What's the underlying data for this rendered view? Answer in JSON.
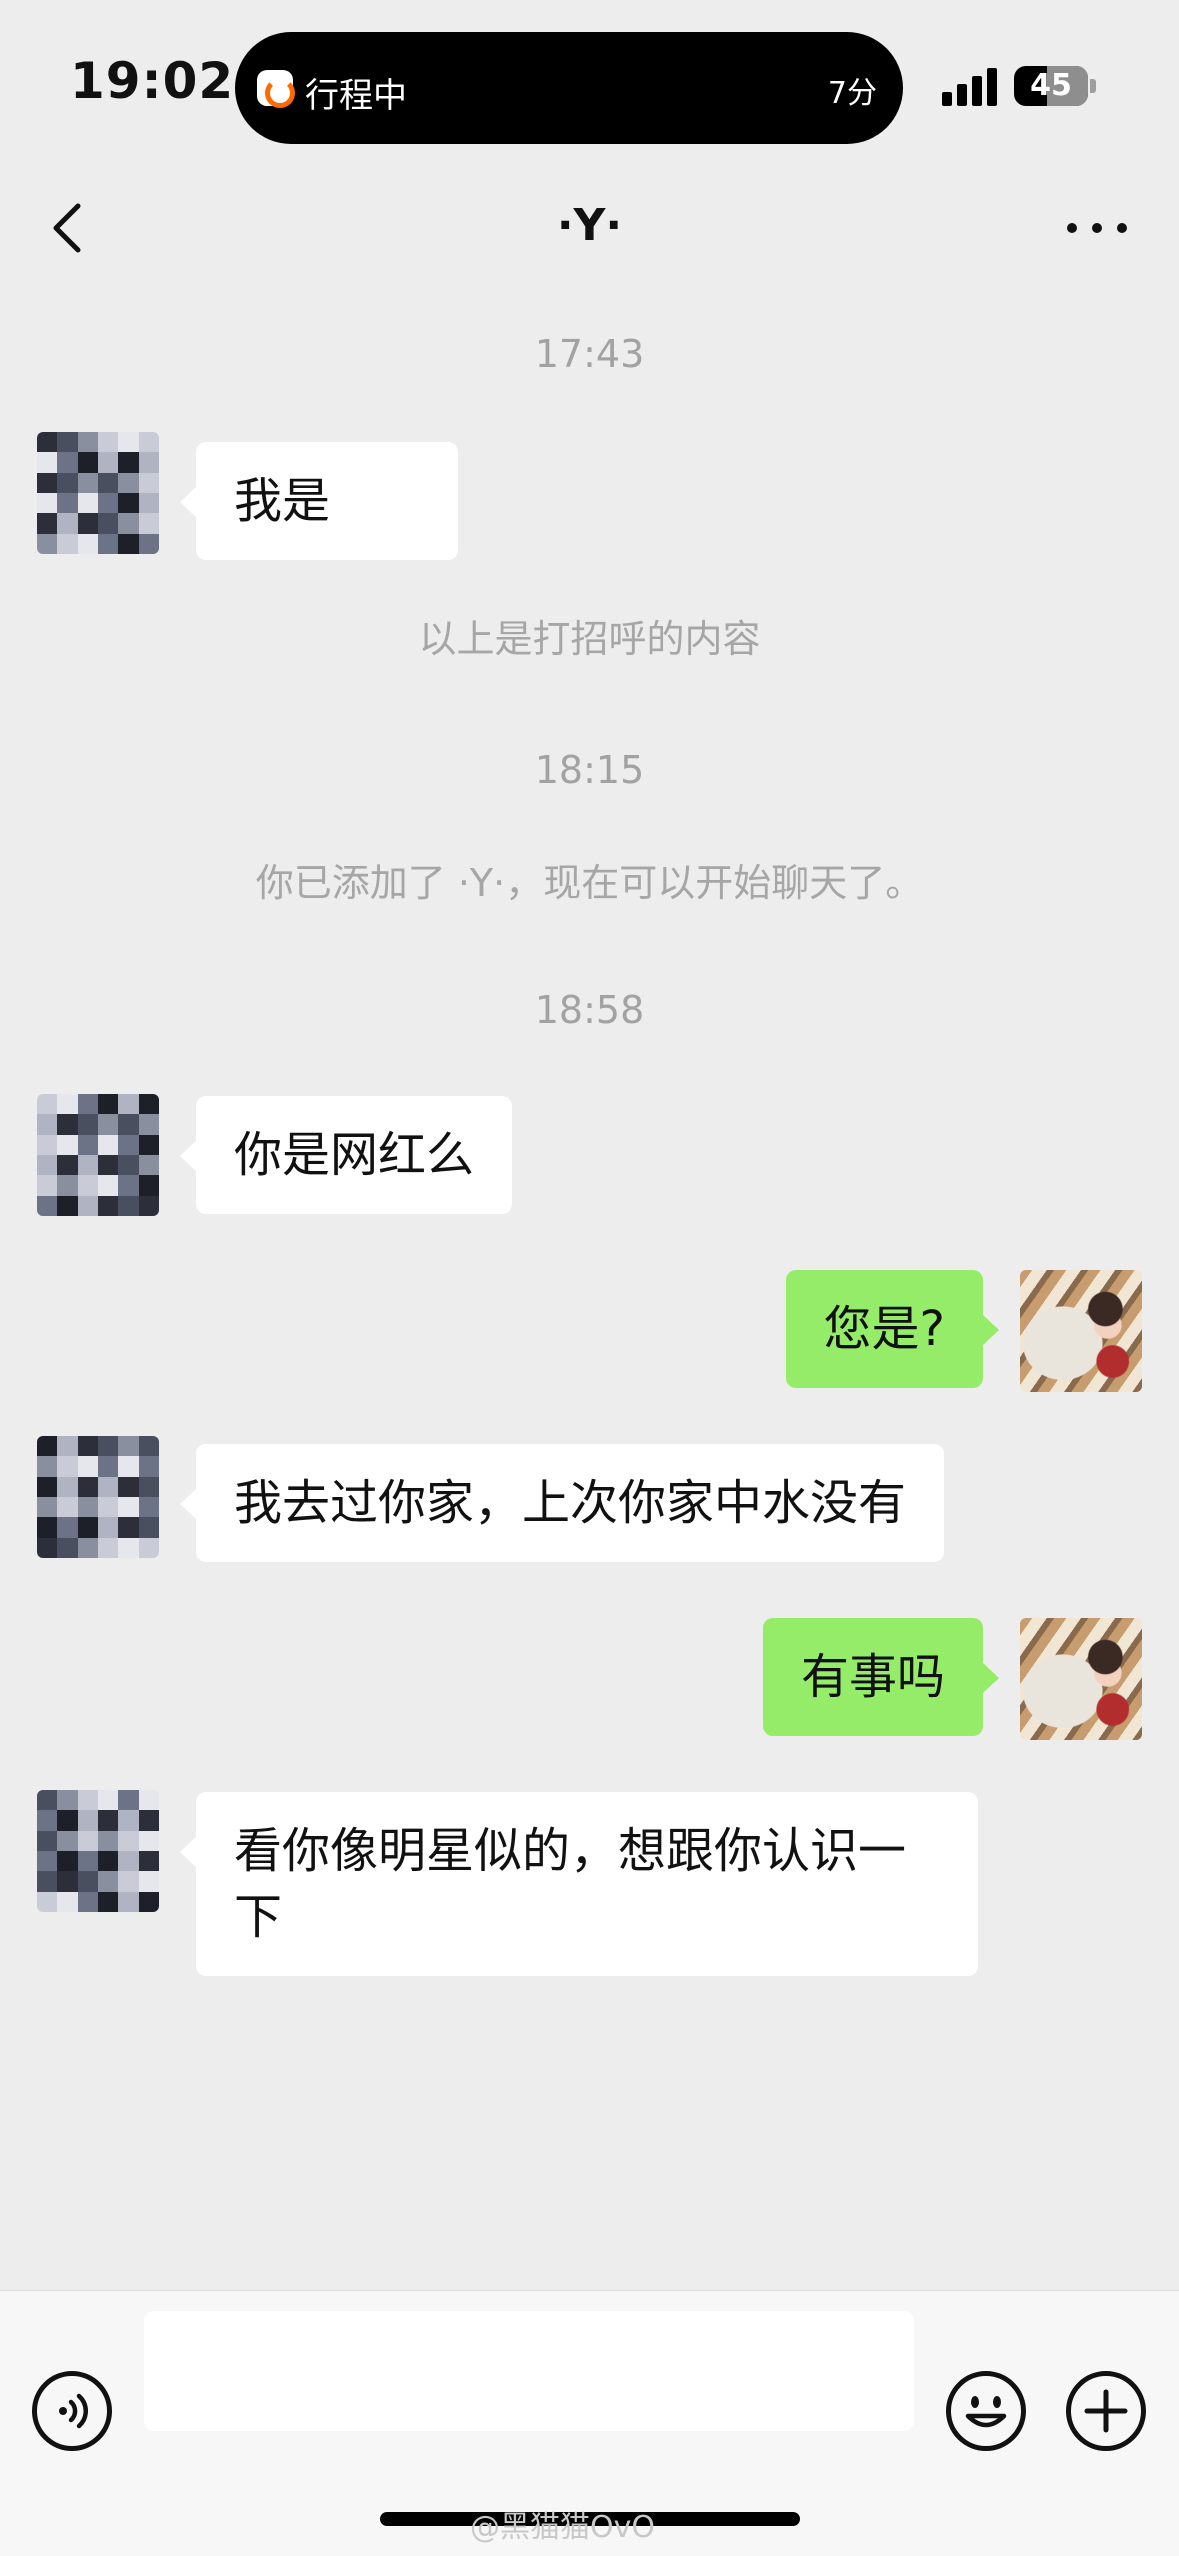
{
  "status_bar": {
    "time": "19:02",
    "island_title": "行程中",
    "island_minutes": "7分",
    "battery_level": "45",
    "battery_fraction": 0.45
  },
  "nav": {
    "title": "·Y·",
    "back_icon": "chevron-left-icon",
    "more_icon": "ellipsis-icon"
  },
  "chat": {
    "timestamps": [
      "17:43",
      "18:15",
      "18:58"
    ],
    "messages": [
      {
        "side": "left",
        "text": "我是"
      },
      {
        "side": "left",
        "text": "你是网红么"
      },
      {
        "side": "right",
        "text": "您是?"
      },
      {
        "side": "left",
        "text": "我去过你家，上次你家中水没有"
      },
      {
        "side": "right",
        "text": "有事吗"
      },
      {
        "side": "left",
        "text": "看你像明星似的，想跟你认识一下"
      }
    ],
    "system_notes": [
      "以上是打招呼的内容",
      "你已添加了 ·Y·，现在可以开始聊天了。"
    ]
  },
  "input_bar": {
    "voice_icon": "voice-icon",
    "input_value": "",
    "emoji_icon": "emoji-icon",
    "plus_icon": "plus-icon"
  },
  "watermark": "@黑猫猫OvO",
  "colors": {
    "background": "#ededed",
    "bubble_self": "#95ec69",
    "bubble_other": "#ffffff"
  }
}
